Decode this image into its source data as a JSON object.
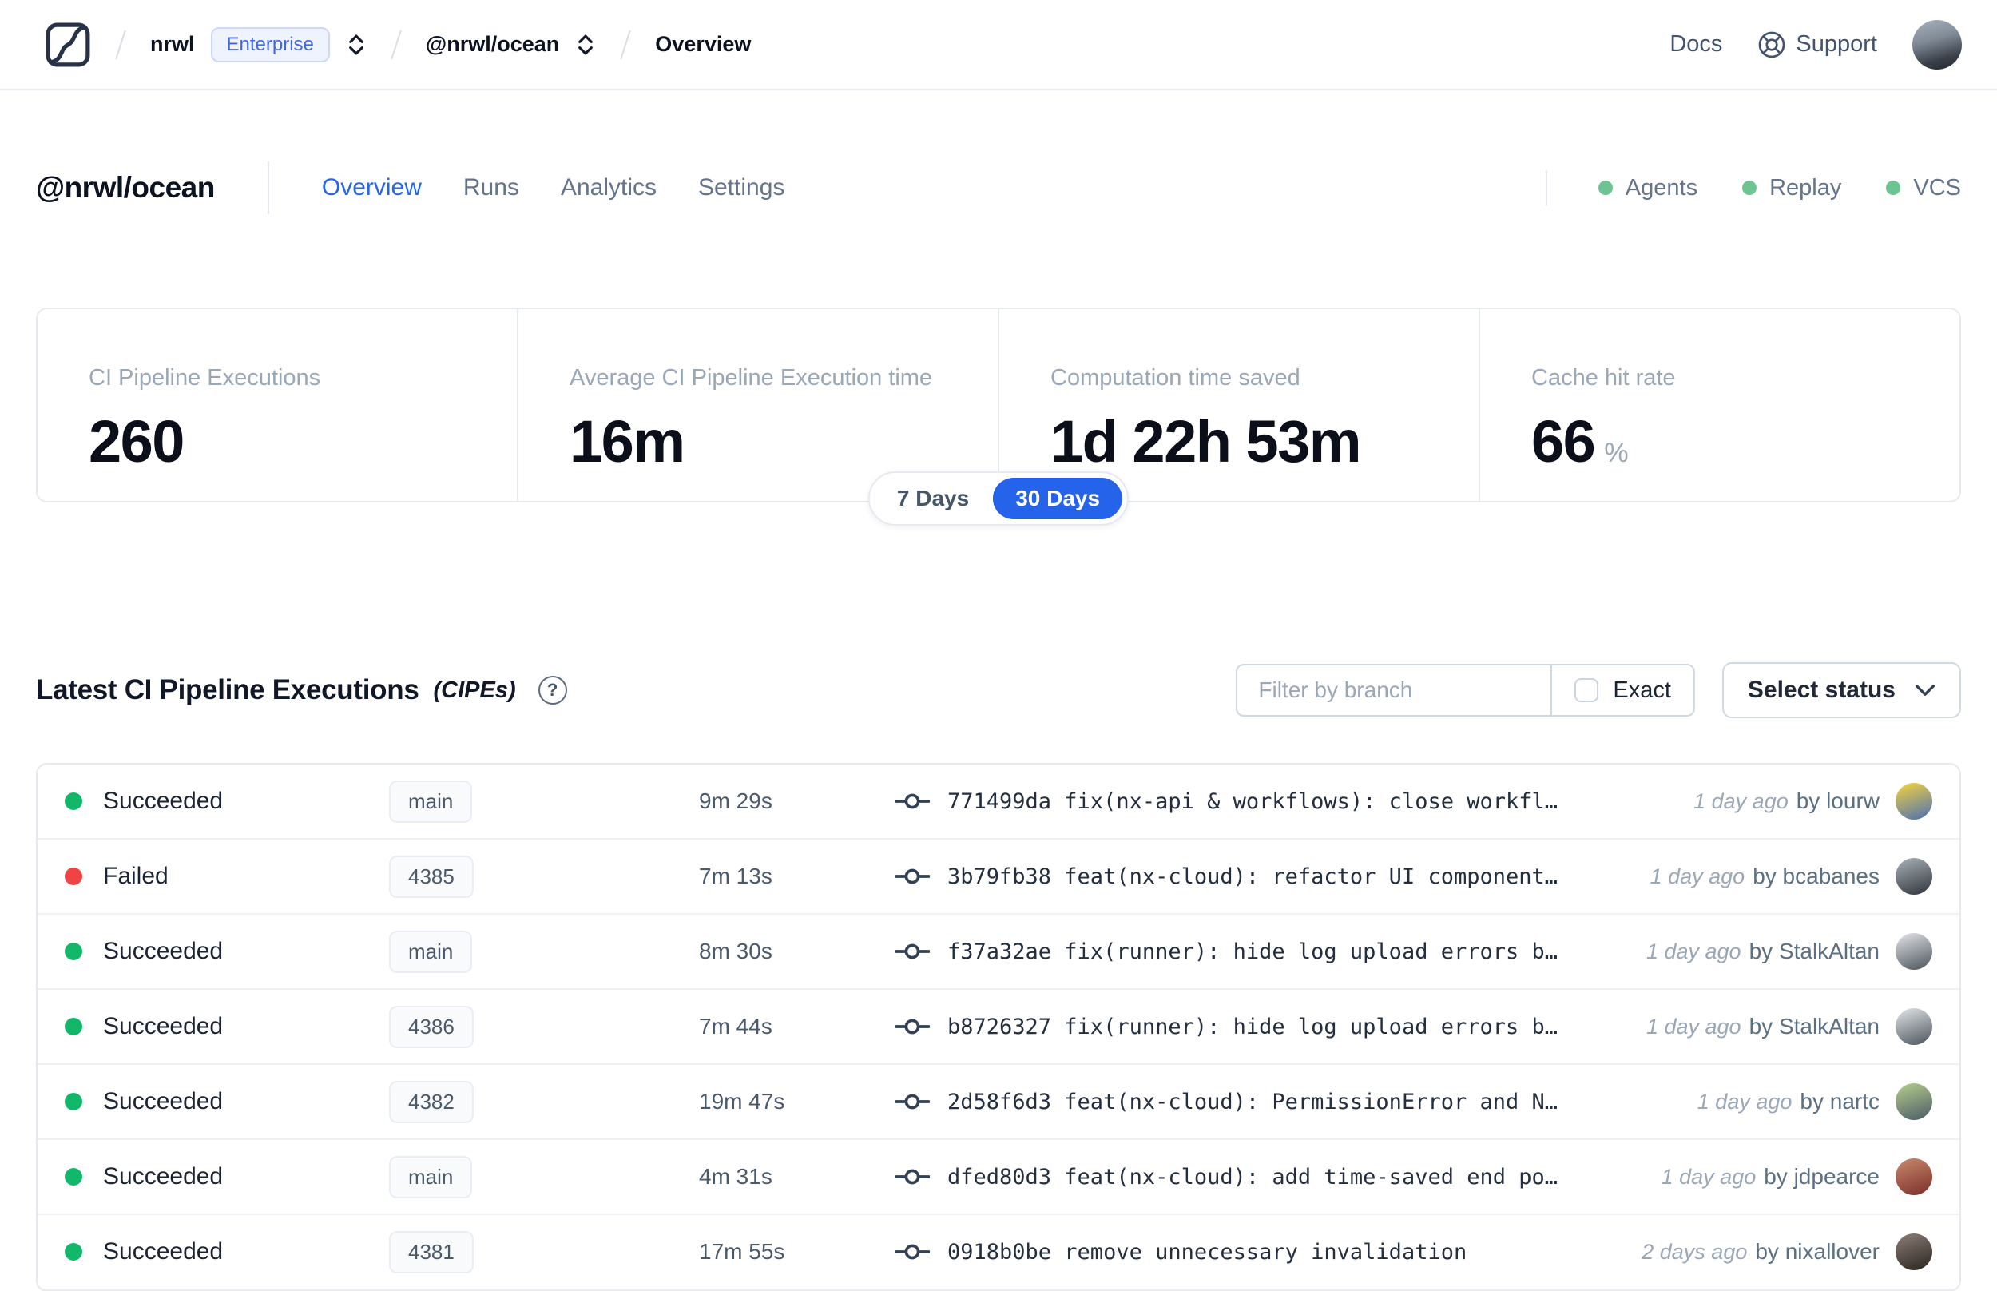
{
  "topnav": {
    "breadcrumb": {
      "org": "nrwl",
      "org_badge": "Enterprise",
      "workspace": "@nrwl/ocean",
      "page": "Overview"
    },
    "docs_label": "Docs",
    "support_label": "Support"
  },
  "workspace": {
    "title": "@nrwl/ocean",
    "tabs": [
      {
        "label": "Overview",
        "active": true
      },
      {
        "label": "Runs",
        "active": false
      },
      {
        "label": "Analytics",
        "active": false
      },
      {
        "label": "Settings",
        "active": false
      }
    ],
    "indicators": [
      {
        "label": "Agents",
        "color": "#6cc493"
      },
      {
        "label": "Replay",
        "color": "#6cc493"
      },
      {
        "label": "VCS",
        "color": "#6cc493"
      }
    ]
  },
  "stats": {
    "cards": [
      {
        "label": "CI Pipeline Executions",
        "value": "260"
      },
      {
        "label": "Average CI Pipeline Execution time",
        "value": "16m"
      },
      {
        "label": "Computation time saved",
        "value": "1d 22h 53m"
      },
      {
        "label": "Cache hit rate",
        "value": "66",
        "suffix": "%"
      }
    ],
    "range_toggle": {
      "options": [
        "7 Days",
        "30 Days"
      ],
      "selected": "30 Days"
    }
  },
  "cipe": {
    "title": "Latest CI Pipeline Executions",
    "title_suffix": "(CIPEs)",
    "help_glyph": "?",
    "filter_placeholder": "Filter by branch",
    "exact_label": "Exact",
    "exact_checked": false,
    "status_button_label": "Select status",
    "rows": [
      {
        "status": "Succeeded",
        "status_color": "#12b76a",
        "branch": "main",
        "duration": "9m 29s",
        "commit": "771499da fix(nx-api & workflows): close workfl…",
        "time": "1 day ago",
        "author": "by lourw",
        "avatar_from": "#f7d43c",
        "avatar_to": "#4a6fb5"
      },
      {
        "status": "Failed",
        "status_color": "#f04444",
        "branch": "4385",
        "duration": "7m 13s",
        "commit": "3b79fb38 feat(nx-cloud): refactor UI component…",
        "time": "1 day ago",
        "author": "by bcabanes",
        "avatar_from": "#aab3bb",
        "avatar_to": "#2e3338"
      },
      {
        "status": "Succeeded",
        "status_color": "#12b76a",
        "branch": "main",
        "duration": "8m 30s",
        "commit": "f37a32ae fix(runner): hide log upload errors b…",
        "time": "1 day ago",
        "author": "by StalkAltan",
        "avatar_from": "#e4e7ea",
        "avatar_to": "#4a525a"
      },
      {
        "status": "Succeeded",
        "status_color": "#12b76a",
        "branch": "4386",
        "duration": "7m 44s",
        "commit": "b8726327 fix(runner): hide log upload errors b…",
        "time": "1 day ago",
        "author": "by StalkAltan",
        "avatar_from": "#e4e7ea",
        "avatar_to": "#4a525a"
      },
      {
        "status": "Succeeded",
        "status_color": "#12b76a",
        "branch": "4382",
        "duration": "19m 47s",
        "commit": "2d58f6d3 feat(nx-cloud): PermissionError and N…",
        "time": "1 day ago",
        "author": "by nartc",
        "avatar_from": "#b5d08e",
        "avatar_to": "#4b5a66"
      },
      {
        "status": "Succeeded",
        "status_color": "#12b76a",
        "branch": "main",
        "duration": "4m 31s",
        "commit": "dfed80d3 feat(nx-cloud): add time-saved end po…",
        "time": "1 day ago",
        "author": "by jdpearce",
        "avatar_from": "#c98a6e",
        "avatar_to": "#7a2e28"
      },
      {
        "status": "Succeeded",
        "status_color": "#12b76a",
        "branch": "4381",
        "duration": "17m 55s",
        "commit": "0918b0be remove unnecessary invalidation",
        "time": "2 days ago",
        "author": "by nixallover",
        "avatar_from": "#8d7f77",
        "avatar_to": "#29241f"
      }
    ]
  },
  "accent_colors": {
    "blue": "#2563eb",
    "green": "#12b76a",
    "red": "#f04444"
  }
}
